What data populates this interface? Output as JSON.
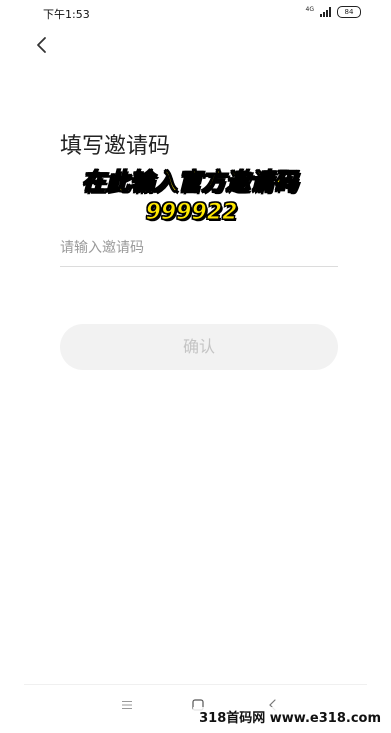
{
  "status_bar": {
    "time": "下午1:53",
    "network": "4G",
    "battery": "84"
  },
  "page": {
    "title": "填写邀请码"
  },
  "promo": {
    "line1": "在此输入官方邀请码",
    "line2": "999922"
  },
  "form": {
    "invite_code": {
      "value": "",
      "placeholder": "请输入邀请码"
    },
    "confirm_label": "确认"
  },
  "watermark": {
    "text": "318首码网 www.e318.com"
  },
  "colors": {
    "promo_text": "#ffe800",
    "confirm_bg": "#f2f2f2",
    "confirm_text": "#c4c4c4"
  },
  "icons": {
    "back": "chevron-left-icon",
    "nav_menu": "menu-icon",
    "nav_home": "square-icon",
    "nav_back": "chevron-left-icon"
  }
}
